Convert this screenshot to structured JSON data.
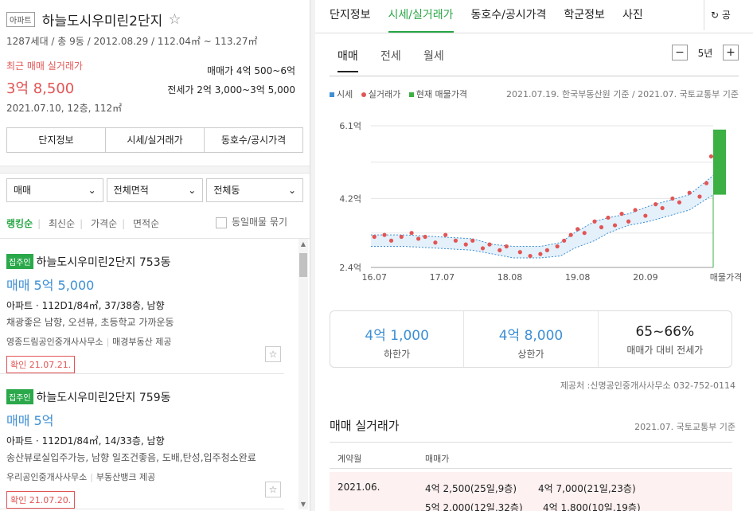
{
  "complex": {
    "type_badge": "아파트",
    "name": "하늘도시우미린2단지",
    "star": "☆",
    "summary": "1287세대 / 총 9동 / 2012.08.29 / 112.04㎡ ~ 113.27㎡"
  },
  "recent": {
    "label": "최근 매매 실거래가",
    "price": "3억 8,500",
    "date": "2021.07.10, 12층, 112㎡",
    "sale_range": "매매가 4억 500~6억",
    "jeonse_range": "전세가 2억 3,000~3억 5,000"
  },
  "left_buttons": [
    "단지정보",
    "시세/실거래가",
    "동호수/공시가격"
  ],
  "filters": [
    "매매",
    "전체면적",
    "전체동"
  ],
  "sort": {
    "items": [
      "랭킹순",
      "최신순",
      "가격순",
      "면적순"
    ],
    "same_listing": "동일매물 묶기"
  },
  "listings": [
    {
      "badge": "집주인",
      "name": "하늘도시우미린2단지 753동",
      "price": "매매 5억 5,000",
      "desc": "아파트 · 112D1/84㎡, 37/38층, 남향",
      "features": "채광좋은 남향, 오션뷰, 초등학교 가까운동",
      "agent": "영종드림공인중개사사무소",
      "provider": "매경부동산 제공",
      "confirmed": "확인 21.07.21."
    },
    {
      "badge": "집주인",
      "name": "하늘도시우미린2단지 759동",
      "price": "매매 5억",
      "desc": "아파트 · 112D1/84㎡, 14/33층, 남향",
      "features": "송산뷰로실입주가능, 남향 일조건좋음, 도배,탄성,입주청소완료",
      "agent": "우리공인중개사사무소",
      "provider": "부동산뱅크 제공",
      "confirmed": "확인 21.07.20."
    }
  ],
  "tabs": [
    "단지정보",
    "시세/실거래가",
    "동호수/공시가격",
    "학군정보",
    "사진"
  ],
  "share": "↻ 공",
  "sub_tabs": [
    "매매",
    "전세",
    "월세"
  ],
  "year_control": {
    "minus": "−",
    "value": "5년",
    "plus": "+"
  },
  "legend": {
    "items": [
      "시세",
      "실거래가",
      "현재 매물가격"
    ],
    "source": "2021.07.19. 한국부동산원 기준 / 2021.07. 국토교통부 기준"
  },
  "colors": {
    "accent": "#28a745",
    "sise": "#3d8fd4",
    "deal": "#e25555",
    "listing": "#3cb043"
  },
  "chart_data": {
    "type": "line",
    "x_ticks": [
      "16.07",
      "17.07",
      "18.08",
      "19.08",
      "20.09",
      "매물가격"
    ],
    "y_ticks": [
      "6.1억",
      "4.2억",
      "2.4억"
    ],
    "ylim": [
      2.4,
      6.1
    ],
    "sise_band": {
      "x": [
        2016.5,
        2017.0,
        2017.5,
        2018.0,
        2018.3,
        2018.6,
        2019.0,
        2019.3,
        2019.5,
        2019.8,
        2020.0,
        2020.3,
        2020.6,
        2020.9,
        2021.2,
        2021.55
      ],
      "upper": [
        3.25,
        3.25,
        3.2,
        3.15,
        3.0,
        2.95,
        2.95,
        3.05,
        3.3,
        3.6,
        3.7,
        3.8,
        4.0,
        4.15,
        4.3,
        4.8
      ],
      "lower": [
        2.95,
        2.95,
        2.9,
        2.85,
        2.75,
        2.65,
        2.65,
        2.7,
        2.9,
        3.1,
        3.3,
        3.5,
        3.6,
        3.75,
        3.9,
        4.3
      ]
    },
    "deals": [
      {
        "x": 2016.55,
        "y": 3.2
      },
      {
        "x": 2016.7,
        "y": 3.25
      },
      {
        "x": 2016.8,
        "y": 3.1
      },
      {
        "x": 2016.95,
        "y": 3.2
      },
      {
        "x": 2017.1,
        "y": 3.3
      },
      {
        "x": 2017.2,
        "y": 3.15
      },
      {
        "x": 2017.3,
        "y": 3.2
      },
      {
        "x": 2017.45,
        "y": 3.05
      },
      {
        "x": 2017.6,
        "y": 3.25
      },
      {
        "x": 2017.75,
        "y": 3.1
      },
      {
        "x": 2017.9,
        "y": 3.0
      },
      {
        "x": 2018.0,
        "y": 3.1
      },
      {
        "x": 2018.15,
        "y": 2.9
      },
      {
        "x": 2018.25,
        "y": 3.0
      },
      {
        "x": 2018.4,
        "y": 2.85
      },
      {
        "x": 2018.5,
        "y": 2.95
      },
      {
        "x": 2018.7,
        "y": 2.8
      },
      {
        "x": 2018.85,
        "y": 2.7
      },
      {
        "x": 2019.0,
        "y": 2.75
      },
      {
        "x": 2019.1,
        "y": 2.85
      },
      {
        "x": 2019.25,
        "y": 2.95
      },
      {
        "x": 2019.35,
        "y": 3.1
      },
      {
        "x": 2019.45,
        "y": 3.25
      },
      {
        "x": 2019.55,
        "y": 3.4
      },
      {
        "x": 2019.65,
        "y": 3.3
      },
      {
        "x": 2019.8,
        "y": 3.6
      },
      {
        "x": 2019.9,
        "y": 3.45
      },
      {
        "x": 2020.0,
        "y": 3.7
      },
      {
        "x": 2020.1,
        "y": 3.5
      },
      {
        "x": 2020.2,
        "y": 3.8
      },
      {
        "x": 2020.3,
        "y": 3.6
      },
      {
        "x": 2020.4,
        "y": 3.9
      },
      {
        "x": 2020.55,
        "y": 3.75
      },
      {
        "x": 2020.7,
        "y": 4.05
      },
      {
        "x": 2020.8,
        "y": 3.95
      },
      {
        "x": 2020.95,
        "y": 4.2
      },
      {
        "x": 2021.05,
        "y": 4.1
      },
      {
        "x": 2021.2,
        "y": 4.35
      },
      {
        "x": 2021.35,
        "y": 4.25
      },
      {
        "x": 2021.45,
        "y": 4.6
      },
      {
        "x": 2021.52,
        "y": 5.3
      }
    ],
    "listing_range": [
      4.3,
      6.0
    ]
  },
  "stats": [
    {
      "value": "4억 1,000",
      "label": "하한가"
    },
    {
      "value": "4억 8,000",
      "label": "상한가"
    },
    {
      "value": "65~66%",
      "label": "매매가 대비 전세가"
    }
  ],
  "provider": "제공처 :신명공인중개사사무소 032-752-0114",
  "actual": {
    "title": "매매 실거래가",
    "source": "2021.07. 국토교통부 기준",
    "col_month": "계약월",
    "col_price": "매매가",
    "row_month": "2021.06.",
    "row_prices": [
      "4억 2,500(25일,9층)",
      "4억 7,000(21일,23층)",
      "5억 2,000(12일,32층)",
      "4억 1,800(10일,19층)"
    ]
  }
}
